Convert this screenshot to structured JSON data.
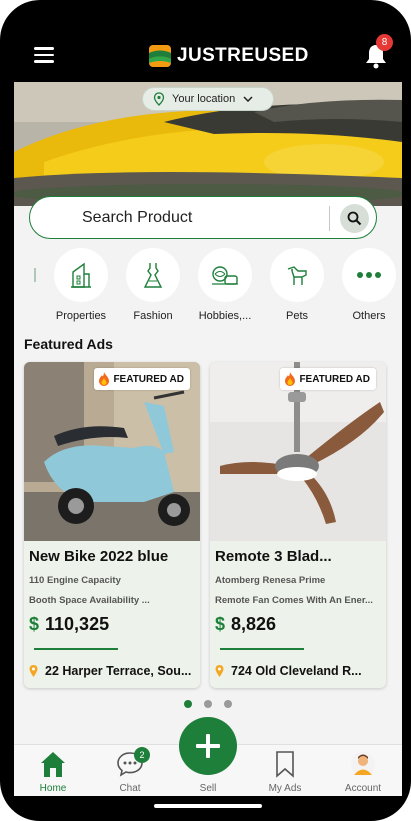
{
  "header": {
    "brand": "JUSTREUSED",
    "notification_count": "8"
  },
  "banner": {
    "location_label": "Your location"
  },
  "search": {
    "placeholder": "Search Product"
  },
  "categories": [
    {
      "label": "Properties",
      "icon": "building-icon"
    },
    {
      "label": "Fashion",
      "icon": "dress-icon"
    },
    {
      "label": "Hobbies,...",
      "icon": "hobbies-icon"
    },
    {
      "label": "Pets",
      "icon": "pet-icon"
    },
    {
      "label": "Others",
      "icon": "more-dots-icon"
    }
  ],
  "featured": {
    "title": "Featured Ads",
    "badge": "FEATURED AD",
    "ads": [
      {
        "title": "New Bike 2022 blue",
        "line1": "110 Engine Capacity",
        "line2": "Booth Space Availability ...",
        "currency": "$",
        "price": "110,325",
        "location": "22 Harper Terrace, Sou..."
      },
      {
        "title": "Remote 3 Blad...",
        "line1": "Atomberg Renesa Prime",
        "line2": "Remote Fan Comes With An Ener...",
        "currency": "$",
        "price": "8,826",
        "location": "724 Old Cleveland R..."
      }
    ]
  },
  "pagination": {
    "active_index": 0,
    "total": 3
  },
  "nav": {
    "home": "Home",
    "chat": "Chat",
    "chat_badge": "2",
    "sell": "Sell",
    "my_ads": "My Ads",
    "account": "Account"
  },
  "colors": {
    "brand_green": "#1e7f3a",
    "badge_red": "#e53935",
    "banner_yellow": "#f2c40c"
  }
}
